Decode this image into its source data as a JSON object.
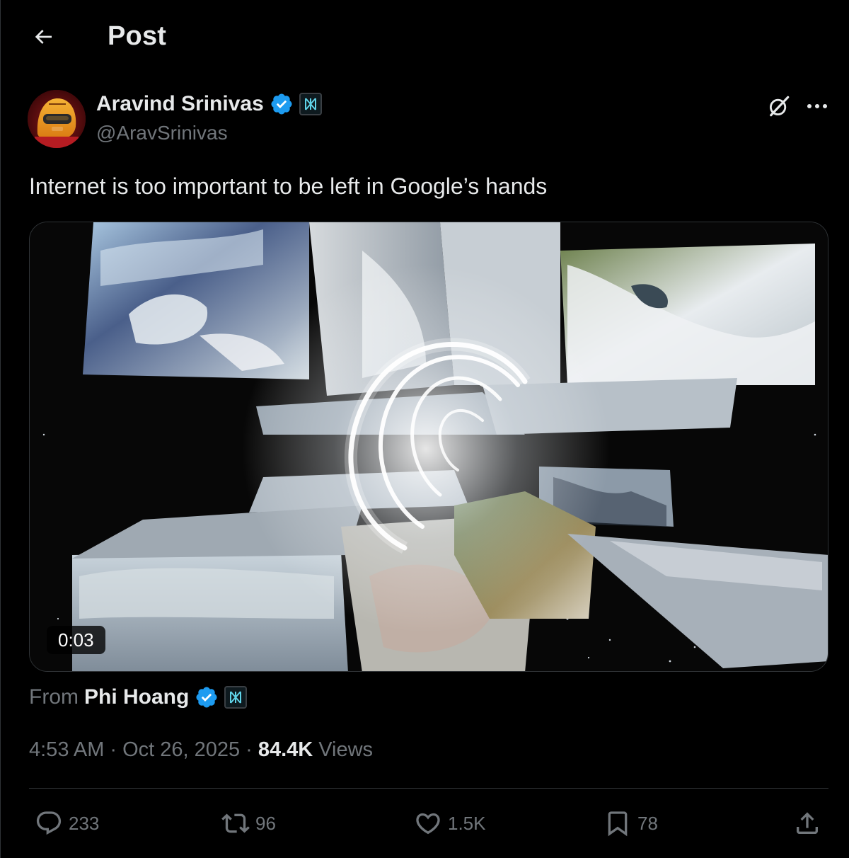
{
  "header": {
    "title": "Post"
  },
  "author": {
    "name": "Aravind Srinivas",
    "handle": "@AravSrinivas",
    "verified_icon": "verified-badge-icon",
    "affiliate_icon": "affiliate-badge-icon"
  },
  "post": {
    "text": "Internet is too important to be left in Google’s hands",
    "media": {
      "type": "video",
      "duration": "0:03"
    },
    "from": {
      "prefix": "From",
      "name": "Phi Hoang"
    },
    "time": "4:53 AM",
    "separator": "·",
    "date": "Oct 26, 2025",
    "views_count": "84.4K",
    "views_label": "Views"
  },
  "actions": {
    "replies": "233",
    "reposts": "96",
    "likes": "1.5K",
    "bookmarks": "78"
  },
  "colors": {
    "background": "#000000",
    "text_primary": "#e7e9ea",
    "text_secondary": "#71767b",
    "border": "#2f3336",
    "verified_blue": "#1d9bf0"
  }
}
